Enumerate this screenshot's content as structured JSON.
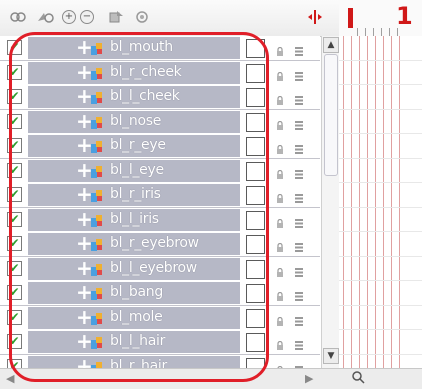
{
  "toolbar": {
    "buttons": [
      {
        "name": "group-layers-icon",
        "glyph": "⊕"
      },
      {
        "name": "ungroup-layers-icon",
        "glyph": "⊘"
      },
      {
        "name": "add-layer-icon",
        "glyph": "+"
      },
      {
        "name": "delete-layer-icon",
        "glyph": "−"
      },
      {
        "name": "add-peg-icon",
        "glyph": "❖"
      },
      {
        "name": "parent-peg-icon",
        "glyph": "❖"
      }
    ],
    "playhead_icon": "playhead-icon"
  },
  "timeline": {
    "current_frame": "1",
    "marker_color": "#d01818"
  },
  "layers": [
    {
      "name": "bl_mouth",
      "visible": true
    },
    {
      "name": "bl_r_cheek",
      "visible": true
    },
    {
      "name": "bl_l_cheek",
      "visible": true
    },
    {
      "name": "bl_nose",
      "visible": true
    },
    {
      "name": "bl_r_eye",
      "visible": true
    },
    {
      "name": "bl_l_eye",
      "visible": true
    },
    {
      "name": "bl_r_iris",
      "visible": true
    },
    {
      "name": "bl_l_iris",
      "visible": true
    },
    {
      "name": "bl_r_eyebrow",
      "visible": true
    },
    {
      "name": "bl_l_eyebrow",
      "visible": true
    },
    {
      "name": "bl_bang",
      "visible": true
    },
    {
      "name": "bl_mole",
      "visible": true
    },
    {
      "name": "bl_l_hair",
      "visible": true
    },
    {
      "name": "bl_r_hair",
      "visible": true
    }
  ],
  "colors": {
    "layer_name_bg": "#b6b8c6",
    "highlight_outline": "#e01e28",
    "check_color": "#2f9b2f"
  },
  "bottom": {
    "zoom_icon": "zoom-icon"
  }
}
